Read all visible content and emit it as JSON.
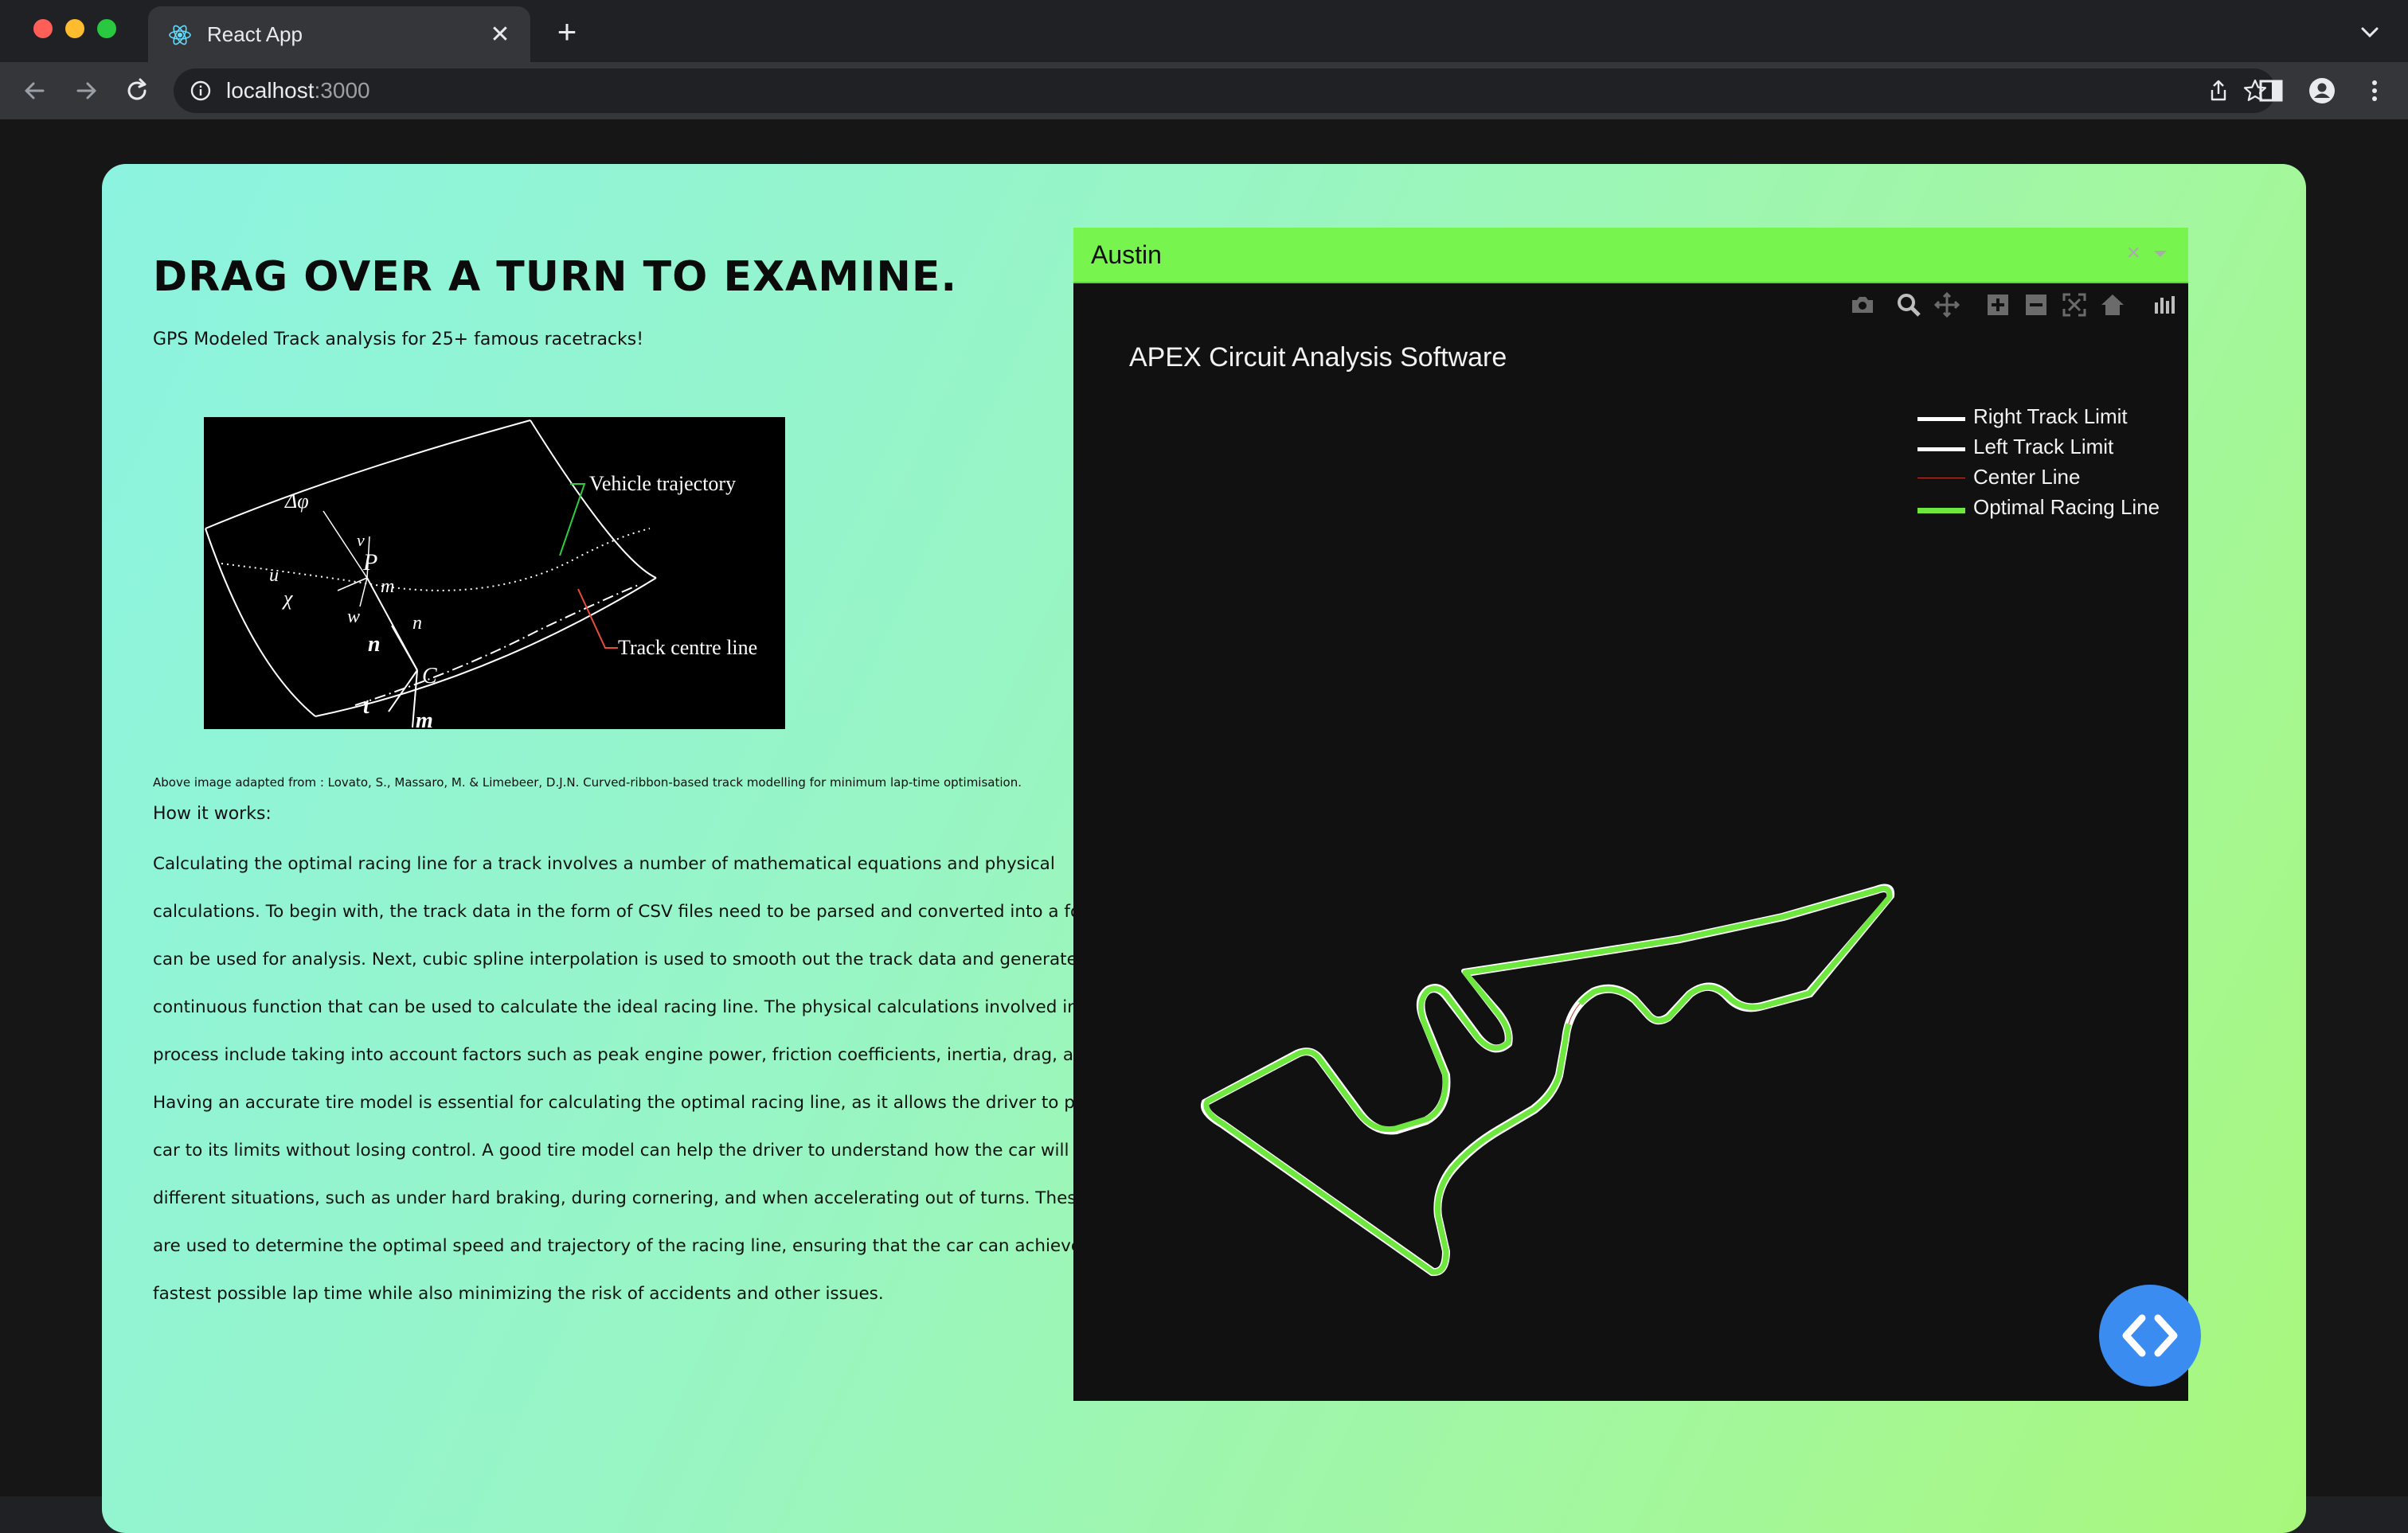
{
  "browser": {
    "tab_title": "React App",
    "url_host": "localhost",
    "url_port": ":3000"
  },
  "page": {
    "headline": "DRAG OVER A TURN TO EXAMINE.",
    "subheadline": "GPS Modeled Track analysis for 25+ famous racetracks!",
    "diagram_labels": {
      "vehicle_trajectory": "Vehicle trajectory",
      "track_centre_line": "Track centre line",
      "delta_phi": "Δφ",
      "v": "v",
      "P": "P",
      "u": "u",
      "m_small": "m",
      "chi": "χ",
      "w": "w",
      "n_small": "n",
      "n_bold": "n",
      "C": "C",
      "t": "t",
      "m_bold": "m"
    },
    "caption": "Above image adapted from : Lovato, S., Massaro, M. & Limebeer, D.J.N. Curved-ribbon-based track modelling for minimum lap-time optimisation.",
    "how_title": "How it works:",
    "body": "Calculating the optimal racing line for a track involves a number of mathematical equations and physical calculations. To begin with, the track data in the form of CSV files need to be parsed and converted into a format that can be used for analysis. Next, cubic spline interpolation is used to smooth out the track data and generate a continuous function that can be used to calculate the ideal racing line. The physical calculations involved in this process include taking into account factors such as peak engine power, friction coefficients, inertia, drag, and more. Having an accurate tire model is essential for calculating the optimal racing line, as it allows the driver to push the car to its limits without losing control. A good tire model can help the driver to understand how the car will behave in different situations, such as under hard braking, during cornering, and when accelerating out of turns. These factors are used to determine the optimal speed and trajectory of the racing line, ensuring that the car can achieve the fastest possible lap time while also minimizing the risk of accidents and other issues."
  },
  "plot": {
    "selected_track": "Austin",
    "clear_symbol": "×",
    "title": "APEX Circuit Analysis Software",
    "legend": [
      {
        "name": "Right Track Limit",
        "color": "#ffffff"
      },
      {
        "name": "Left Track Limit",
        "color": "#ffffff"
      },
      {
        "name": "Center Line",
        "color": "#c0392b"
      },
      {
        "name": "Optimal Racing Line",
        "color": "#6ee83f"
      }
    ],
    "modebar": [
      "camera-icon",
      "zoom-icon",
      "pan-icon",
      "zoom-in-icon",
      "zoom-out-icon",
      "autoscale-icon",
      "reset-axes-icon",
      "plotly-logo-icon"
    ]
  },
  "colors": {
    "accent_green": "#77f54e",
    "racing_line": "#6ee83f",
    "fab_blue": "#3b8cf0"
  }
}
